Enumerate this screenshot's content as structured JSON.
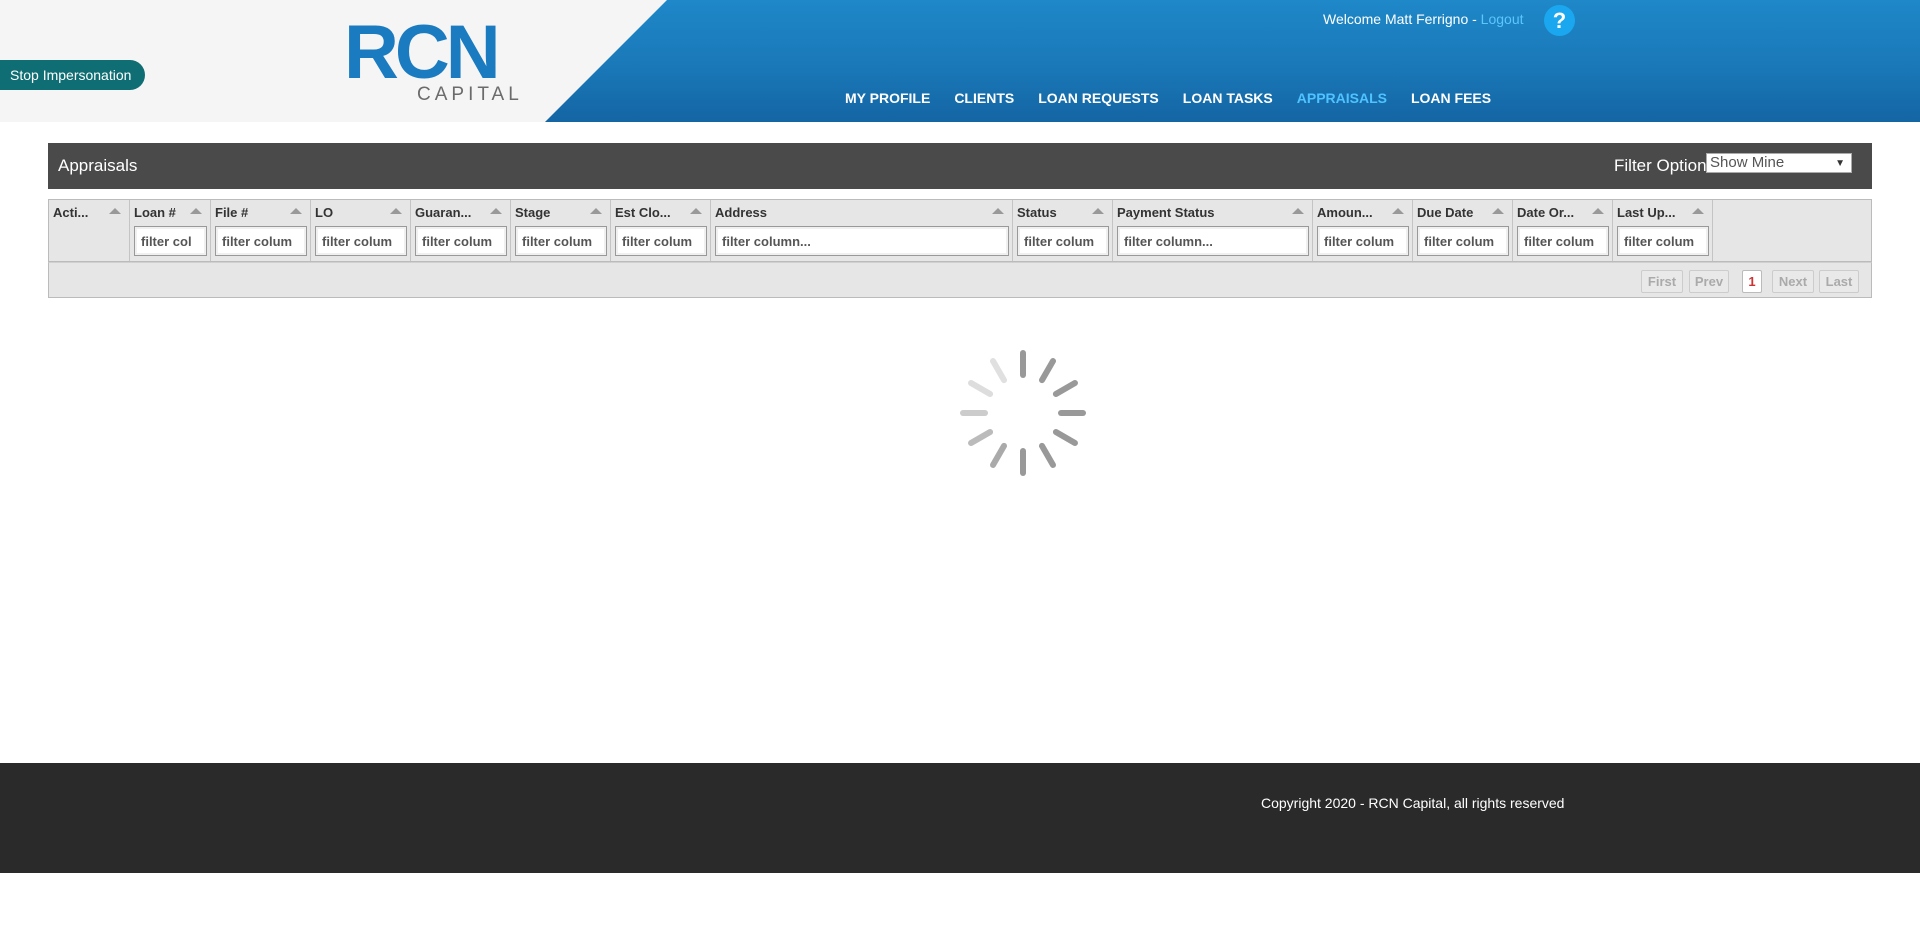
{
  "header": {
    "stop_impersonation_label": "Stop Impersonation",
    "logo_text_main": "RCN",
    "logo_text_sub": "CAPITAL",
    "welcome_text": "Welcome Matt Ferrigno - ",
    "logout_label": "Logout",
    "help_label": "?",
    "nav": [
      {
        "label": "MY PROFILE",
        "active": false
      },
      {
        "label": "CLIENTS",
        "active": false
      },
      {
        "label": "LOAN REQUESTS",
        "active": false
      },
      {
        "label": "LOAN TASKS",
        "active": false
      },
      {
        "label": "APPRAISALS",
        "active": true
      },
      {
        "label": "LOAN FEES",
        "active": false
      }
    ]
  },
  "panel": {
    "title": "Appraisals",
    "filter_label": "Filter Option:",
    "filter_value": "Show Mine"
  },
  "grid": {
    "columns": [
      {
        "header": "Acti...",
        "filter": null
      },
      {
        "header": "Loan #",
        "filter": "filter col"
      },
      {
        "header": "File #",
        "filter": "filter colum"
      },
      {
        "header": "LO",
        "filter": "filter colum"
      },
      {
        "header": "Guaran...",
        "filter": "filter colum"
      },
      {
        "header": "Stage",
        "filter": "filter colum"
      },
      {
        "header": "Est Clo...",
        "filter": "filter colum"
      },
      {
        "header": "Address",
        "filter": "filter column..."
      },
      {
        "header": "Status",
        "filter": "filter colum"
      },
      {
        "header": "Payment Status",
        "filter": "filter column..."
      },
      {
        "header": "Amoun...",
        "filter": "filter colum"
      },
      {
        "header": "Due Date",
        "filter": "filter colum"
      },
      {
        "header": "Date Or...",
        "filter": "filter colum"
      },
      {
        "header": "Last Up...",
        "filter": "filter colum"
      }
    ]
  },
  "pager": {
    "first": "First",
    "prev": "Prev",
    "current_page": "1",
    "next": "Next",
    "last": "Last"
  },
  "footer": {
    "copyright": "Copyright 2020 - RCN Capital, all rights reserved"
  },
  "colors": {
    "header_blue": "#1a78b8",
    "nav_active": "#4fc3ff",
    "stop_button": "#0f6e73",
    "panel_bar": "#4a4a4a",
    "footer": "#2a2a2a",
    "logo_blue": "#1a7bc0",
    "logo_gray": "#6b6b6b"
  },
  "icons": {
    "help": "question-circle-icon",
    "spinner": "loading-spinner-icon",
    "sort": "sort-up-caret-icon"
  }
}
